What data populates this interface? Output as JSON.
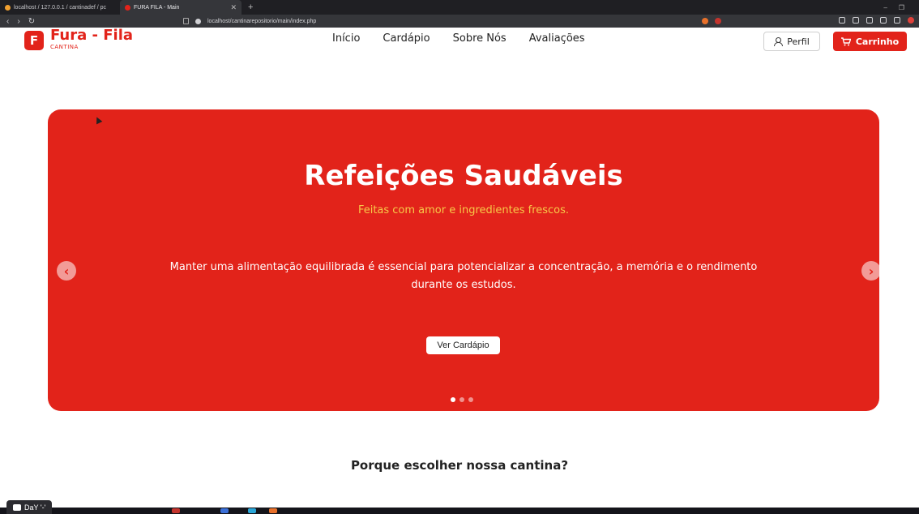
{
  "browser": {
    "tabs": [
      {
        "label": "localhost / 127.0.0.1 / cantinadef / pc",
        "active": false
      },
      {
        "label": "FURA FILA - Main",
        "active": true
      }
    ],
    "url": "localhost/cantinarepositorio/main/index.php"
  },
  "header": {
    "logo_letter": "F",
    "logo_title": "Fura - Fila",
    "logo_subtitle": "CANTINA",
    "nav": [
      "Início",
      "Cardápio",
      "Sobre Nós",
      "Avaliações"
    ],
    "perfil_label": "Perfil",
    "carrinho_label": "Carrinho"
  },
  "hero": {
    "title": "Refeições Saudáveis",
    "subtitle": "Feitas com amor e ingredientes frescos.",
    "description": "Manter uma alimentação equilibrada é essencial para potencializar a concentração, a memória e o rendimento durante os estudos.",
    "button_label": "Ver Cardápio",
    "slides_total": 3,
    "slide_active": 1
  },
  "section": {
    "title": "Porque escolher nossa cantina?"
  },
  "overlay": {
    "chip_label": "DaY '-'"
  },
  "colors": {
    "brand_red": "#e2231a",
    "accent_yellow": "#f7c948"
  }
}
